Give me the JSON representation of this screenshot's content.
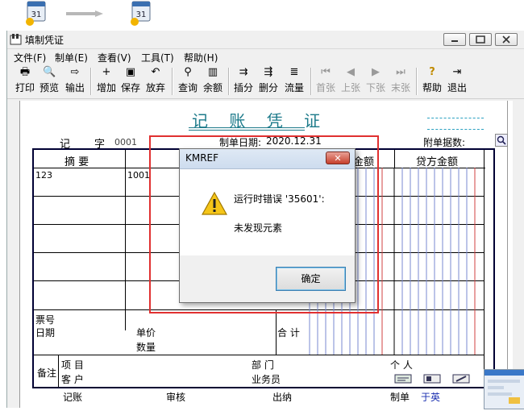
{
  "window": {
    "title": "填制凭证"
  },
  "menu": [
    "文件(F)",
    "制单(E)",
    "查看(V)",
    "工具(T)",
    "帮助(H)"
  ],
  "toolbar": [
    {
      "label": "打印",
      "icon": "printer-icon",
      "glyph": "🖶"
    },
    {
      "label": "预览",
      "icon": "preview-icon",
      "glyph": "🔍"
    },
    {
      "label": "输出",
      "icon": "export-icon",
      "glyph": "⇨"
    },
    {
      "label": "增加",
      "icon": "add-icon",
      "glyph": "+"
    },
    {
      "label": "保存",
      "icon": "save-icon",
      "glyph": "▣"
    },
    {
      "label": "放弃",
      "icon": "undo-icon",
      "glyph": "↶"
    },
    {
      "label": "查询",
      "icon": "binoculars-icon",
      "glyph": "⚲"
    },
    {
      "label": "余额",
      "icon": "chart-icon",
      "glyph": "▥"
    },
    {
      "label": "插分",
      "icon": "insert-row-icon",
      "glyph": "⇉"
    },
    {
      "label": "删分",
      "icon": "delete-row-icon",
      "glyph": "⇶"
    },
    {
      "label": "流量",
      "icon": "flow-icon",
      "glyph": "≣"
    },
    {
      "label": "首张",
      "icon": "first-icon",
      "glyph": "⏮"
    },
    {
      "label": "上张",
      "icon": "prev-icon",
      "glyph": "◀"
    },
    {
      "label": "下张",
      "icon": "next-icon",
      "glyph": "▶"
    },
    {
      "label": "末张",
      "icon": "last-icon",
      "glyph": "⏭"
    },
    {
      "label": "帮助",
      "icon": "help-icon",
      "glyph": "?"
    },
    {
      "label": "退出",
      "icon": "exit-icon",
      "glyph": "⇥"
    }
  ],
  "voucher": {
    "title": "记 账 凭 证",
    "word_label": "记",
    "char_label": "字",
    "number": "0001",
    "date_label": "制单日期:",
    "date": "2020.12.31",
    "attach_label": "附单据数:",
    "col_summary": "摘 要",
    "col_debit_partial": "金额",
    "col_credit": "贷方金额",
    "row1_summary": "123",
    "row1_account": "1001",
    "ticket_no": "票号",
    "ticket_date": "日期",
    "unit_price": "单价",
    "quantity": "数量",
    "total": "合 计",
    "remark": "备注",
    "project": "项 目",
    "customer": "客 户",
    "department": "部 门",
    "salesperson": "业务员",
    "person": "个 人",
    "footer": {
      "bookkeeper": "记账",
      "reviewer": "审核",
      "cashier": "出纳",
      "maker": "制单",
      "maker_name": "于英"
    }
  },
  "dialog": {
    "title": "KMREF",
    "close": "✕",
    "message": "运行时错误 '35601':",
    "detail": "未发现元素",
    "ok": "确定"
  }
}
